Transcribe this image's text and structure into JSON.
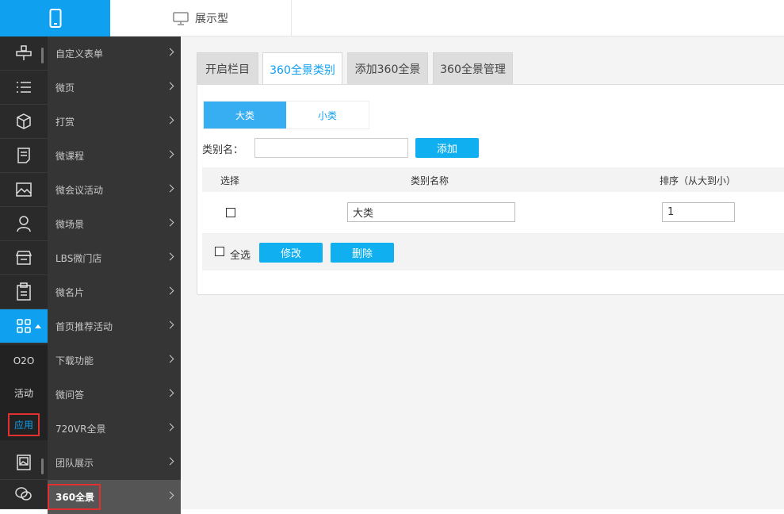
{
  "topbar": {
    "mobile_icon": "phone-icon",
    "display_icon": "monitor-icon",
    "display_label": "展示型"
  },
  "rail": {
    "icons": [
      "joystick-icon",
      "list-icon",
      "box-icon",
      "document-icon",
      "image-icon",
      "user-icon",
      "store-icon",
      "clipboard-icon",
      "apps-icon",
      "photo-frame-icon",
      "wechat-icon"
    ],
    "subitems": [
      "O2O",
      "活动",
      "应用"
    ]
  },
  "submenu": {
    "items": [
      "自定义表单",
      "微页",
      "打赏",
      "微课程",
      "微会议活动",
      "微场景",
      "LBS微门店",
      "微名片",
      "首页推荐活动",
      "下载功能",
      "微问答",
      "720VR全景",
      "团队展示",
      "360全景"
    ],
    "active_index": 13
  },
  "tabs": [
    "开启栏目",
    "360全景类别",
    "添加360全景",
    "360全景管理"
  ],
  "active_tab": 1,
  "segment": {
    "options": [
      "大类",
      "小类"
    ],
    "selected": "大类"
  },
  "form": {
    "label": "类别名：",
    "value": "",
    "add_button": "添加"
  },
  "table": {
    "headers": [
      "选择",
      "类别名称",
      "排序（从大到小）"
    ],
    "rows": [
      {
        "checked": false,
        "name": "大类",
        "sort": "1"
      }
    ],
    "select_all_label": "全选",
    "edit_button": "修改",
    "delete_button": "删除"
  },
  "colors": {
    "accent": "#10a0f0",
    "rail_bg": "#2a2a2a",
    "submenu_bg": "#353535",
    "highlight_border": "#e03030"
  }
}
